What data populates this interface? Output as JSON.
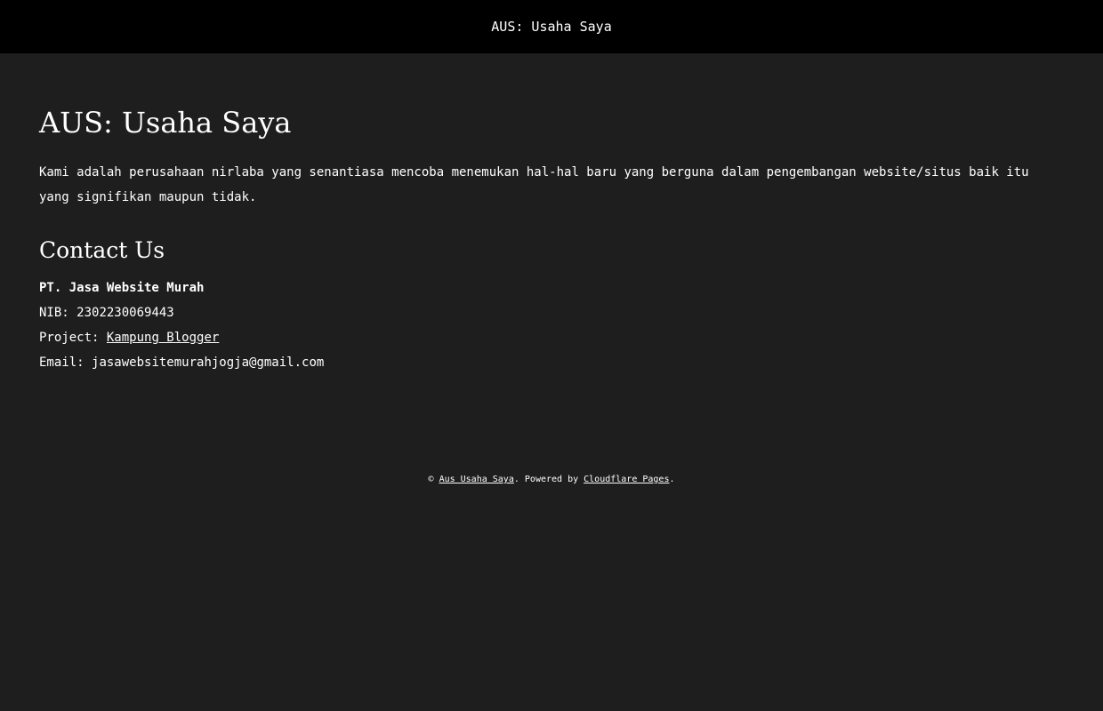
{
  "header": {
    "title": "AUS: Usaha Saya"
  },
  "main": {
    "title": "AUS: Usaha Saya",
    "description": "Kami adalah perusahaan nirlaba yang senantiasa mencoba menemukan hal-hal baru yang berguna dalam pengembangan website/situs baik itu yang signifikan maupun tidak.",
    "contact": {
      "heading": "Contact Us",
      "company": "PT. Jasa Website Murah",
      "nib_label": "NIB:",
      "nib_value": "2302230069443",
      "project_label": "Project:",
      "project_link": "Kampung Blogger",
      "email_label": "Email:",
      "email_value": "jasawebsitemurahjogja@gmail.com"
    }
  },
  "footer": {
    "copyright_symbol": "©",
    "site_link": "Aus Usaha Saya",
    "powered_text": ". Powered by",
    "powered_link": "Cloudflare Pages",
    "end_punct": "."
  },
  "colors": {
    "background": "#1e1e1e",
    "header_background": "#000000",
    "text": "#ffffff"
  }
}
